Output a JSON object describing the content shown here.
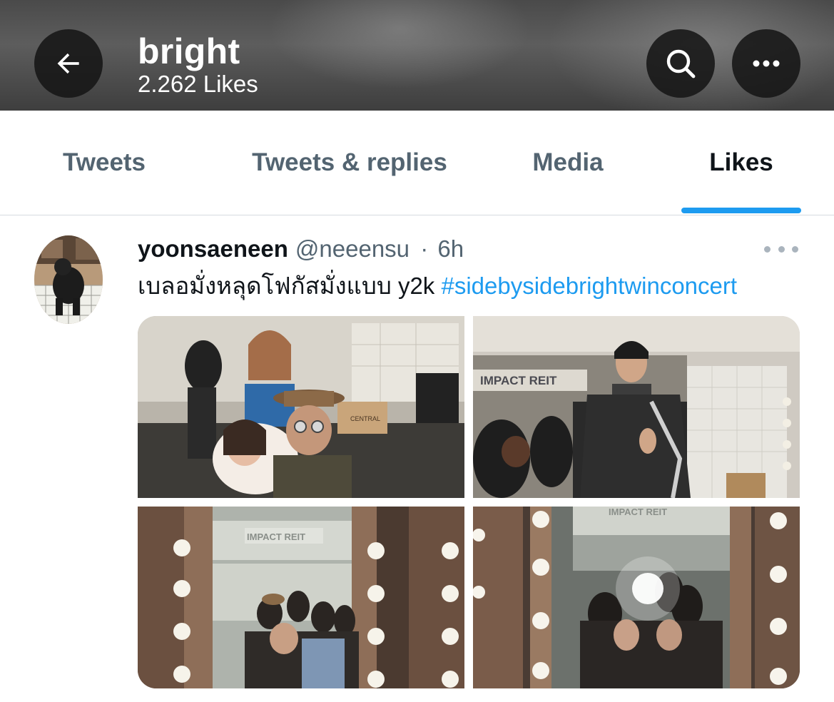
{
  "header": {
    "title": "bright",
    "subtitle": "2.262 Likes",
    "back_icon": "arrow-left-icon",
    "search_icon": "search-icon",
    "more_icon": "more-horizontal-icon"
  },
  "tabs": [
    {
      "label": "Tweets",
      "active": false
    },
    {
      "label": "Tweets & replies",
      "active": false
    },
    {
      "label": "Media",
      "active": false
    },
    {
      "label": "Likes",
      "active": true
    }
  ],
  "tweet": {
    "display_name": "yoonsaeneen",
    "handle": "@neeensu",
    "separator": "·",
    "time": "6h",
    "text": "เบลอมั่งหลุดโฟกัสมั่งแบบ y2k",
    "hashtag": "#sidebysidebrightwinconcert",
    "photos": [
      {
        "sign_text": "CENTRAL"
      },
      {
        "sign_text": "IMPACT REIT"
      },
      {
        "sign_text": "IMPACT REIT"
      },
      {
        "sign_text": "IMPACT REIT"
      }
    ]
  },
  "colors": {
    "accent": "#1d9bf0",
    "secondary_text": "#536471",
    "primary_text": "#0f1419"
  }
}
